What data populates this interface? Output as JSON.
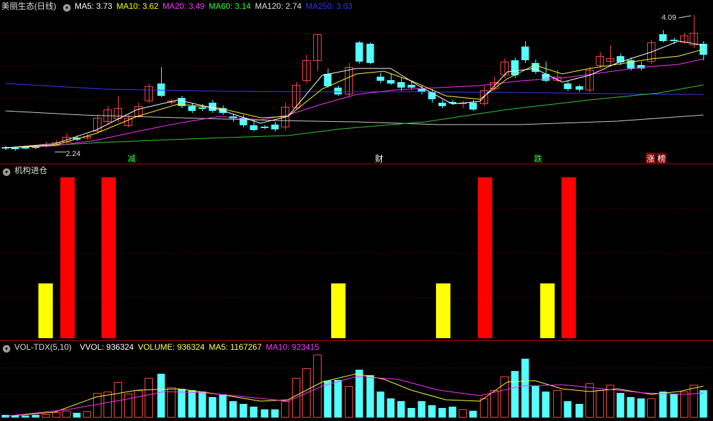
{
  "price_panel": {
    "title": "美丽生态(日线)",
    "ma_labels": [
      {
        "text": "MA5: 3.73",
        "color": "#ffffff"
      },
      {
        "text": "MA10: 3.62",
        "color": "#ffff00"
      },
      {
        "text": "MA20: 3.49",
        "color": "#ff33ff"
      },
      {
        "text": "MA60: 3.14",
        "color": "#33ff33"
      },
      {
        "text": "MA120: 2.74",
        "color": "#dddddd"
      },
      {
        "text": "MA250: 3.03",
        "color": "#3333ff"
      }
    ],
    "high_label": "4.09",
    "low_label": "2.24",
    "event_markers": [
      {
        "text": "减",
        "color": "#33ff33"
      },
      {
        "text": "财",
        "color": "#ffffff"
      },
      {
        "text": "跌",
        "color": "#33ff33"
      },
      {
        "text": "涨",
        "color": "#ffffff"
      },
      {
        "text": "榜",
        "color": "#ffffff"
      }
    ]
  },
  "inst_panel": {
    "title": "机构进仓",
    "bars": [
      {
        "color": "#ffff00",
        "level": 0.34
      },
      {
        "color": "#ff0000",
        "level": 1.0
      },
      {
        "color": "#ff0000",
        "level": 1.0
      },
      {
        "color": "#ffff00",
        "level": 0.34
      },
      {
        "color": "#ffff00",
        "level": 0.34
      },
      {
        "color": "#ff0000",
        "level": 1.0
      },
      {
        "color": "#ffff00",
        "level": 0.34
      },
      {
        "color": "#ff0000",
        "level": 1.0
      }
    ]
  },
  "vol_panel": {
    "title": "VOL-TDX(5,10)",
    "labels": [
      {
        "text": "VVOL: 936324",
        "color": "#ffffff"
      },
      {
        "text": "VOLUME: 936324",
        "color": "#ffff66"
      },
      {
        "text": "MA5: 1167267",
        "color": "#ffff66"
      },
      {
        "text": "MA10: 923415",
        "color": "#ff33ff"
      }
    ]
  },
  "colors": {
    "up": "#ff4444",
    "down": "#54ffff",
    "grid": "#7a0000",
    "border": "#b00000"
  }
}
